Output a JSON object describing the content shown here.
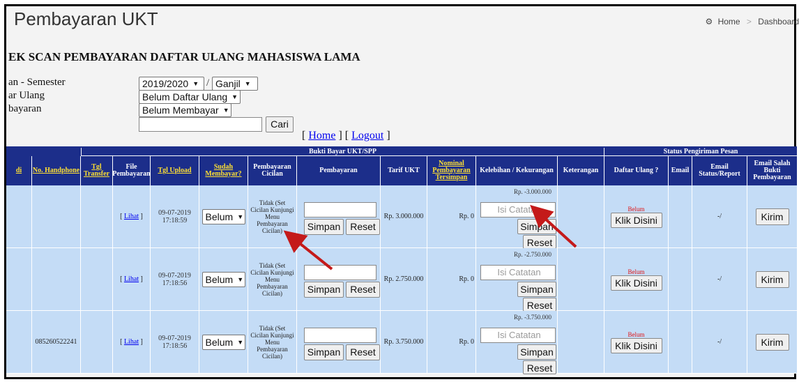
{
  "page": {
    "title": "Pembayaran UKT",
    "breadcrumb": {
      "home": "Home",
      "sep": ">",
      "current": "Dashboard"
    },
    "heading": "EK SCAN PEMBAYARAN DAFTAR ULANG MAHASISWA LAMA"
  },
  "filters": {
    "label_semester": "an - Semester",
    "label_daftar": "ar Ulang",
    "label_bayar": "bayaran",
    "tahun": "2019/2020",
    "slash": "/",
    "semester": "Ganjil",
    "daftar_ulang": "Belum Daftar Ulang",
    "status_bayar": "Belum Membayar",
    "search_value": "",
    "cari": "Cari"
  },
  "nav": {
    "open1": "[ ",
    "home": "Home",
    "mid": " ] [ ",
    "logout": "Logout",
    "close": " ]"
  },
  "table": {
    "group_bukti": "Bukti Bayar UKT/SPP",
    "group_status": "Status Pengiriman Pesan",
    "headers": {
      "di": "di",
      "no_hp": "No. Handphone",
      "tgl_transfer": "Tgl Transfer",
      "file_pembayaran": "File Pembayaran",
      "tgl_upload": "Tgl Upload",
      "sudah_membayar": "Sudah Membayar?",
      "pembayaran_cicilan": "Pembayaran Cicilan",
      "pembayaran": "Pembayaran",
      "tarif_ukt": "Tarif UKT",
      "nominal_tersimpan": "Nominal Pembayaran Tersimpan",
      "kelebihan": "Kelebihan / Kekurangan",
      "keterangan": "Keterangan",
      "daftar_ulang": "Daftar Ulang ?",
      "email": "Email",
      "email_status": "Email Status/Report",
      "email_salah": "Email Salah Bukti Pembayaran"
    },
    "rows": [
      {
        "phone": "",
        "lihat": "Lihat",
        "date": "09-07-2019",
        "time": "17:18:59",
        "sudah": "Belum",
        "cicilan": "Tidak (Set Cicilan Kunjungi Menu Pembayaran Cicilan)",
        "tarif": "Rp. 3.000.000",
        "tersimpan": "Rp. 0",
        "selisih": "Rp. -3.000.000",
        "catatan_placeholder": "Isi Catatan",
        "daftar_status": "Belum",
        "email_status": "-/"
      },
      {
        "phone": "",
        "lihat": "Lihat",
        "date": "09-07-2019",
        "time": "17:18:56",
        "sudah": "Belum",
        "cicilan": "Tidak (Set Cicilan Kunjungi Menu Pembayaran Cicilan)",
        "tarif": "Rp. 2.750.000",
        "tersimpan": "Rp. 0",
        "selisih": "Rp. -2.750.000",
        "catatan_placeholder": "Isi Catatan",
        "daftar_status": "Belum",
        "email_status": "-/"
      },
      {
        "phone": "085260522241",
        "lihat": "Lihat",
        "date": "09-07-2019",
        "time": "17:18:56",
        "sudah": "Belum",
        "cicilan": "Tidak (Set Cicilan Kunjungi Menu Pembayaran Cicilan)",
        "tarif": "Rp. 3.750.000",
        "tersimpan": "Rp. 0",
        "selisih": "Rp. -3.750.000",
        "catatan_placeholder": "Isi Catatan",
        "daftar_status": "Belum",
        "email_status": "-/"
      }
    ],
    "buttons": {
      "simpan": "Simpan",
      "reset": "Reset",
      "klik": "Klik Disini",
      "kirim": "Kirim"
    }
  },
  "colors": {
    "header_bg": "#1c2e8a",
    "link_yellow": "#ffe033",
    "arrow": "#c41a1a",
    "row_bg": "#c4dcf6"
  }
}
